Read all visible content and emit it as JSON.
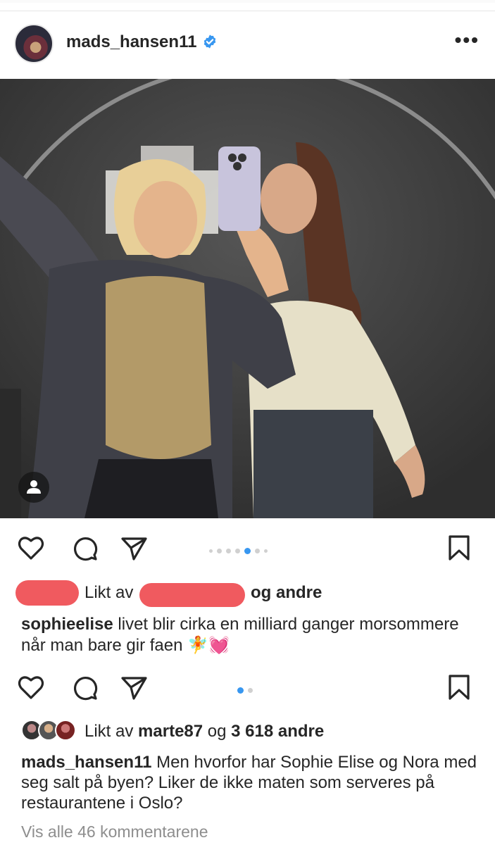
{
  "post": {
    "username": "mads_hansen11",
    "verified": true,
    "more_label": "•••"
  },
  "inner_post": {
    "liked_by_prefix": "Likt av",
    "liked_by_suffix": "og andre",
    "caption_user": "sophieelise",
    "caption_text": "livet blir cirka en milliard ganger morsommere når man bare gir faen",
    "caption_emoji": "🧚💓"
  },
  "outer_post": {
    "liked_by_prefix": "Likt av",
    "liked_by_user": "marte87",
    "liked_by_middle": "og",
    "liked_by_count": "3 618 andre",
    "caption_user": "mads_hansen11",
    "caption_text": "Men hvorfor har Sophie Elise og Nora med seg salt på byen? Liker de ikke maten som serveres på restaurantene i Oslo?",
    "view_all_comments": "Vis alle 46 kommentarene"
  },
  "carousel_inner": {
    "count": 7,
    "active_index": 4
  },
  "carousel_outer": {
    "count": 2,
    "active_index": 0
  },
  "colors": {
    "accent_blue": "#3897f0",
    "redaction": "#f05a5f",
    "text": "#262626",
    "muted": "#8e8e8e"
  },
  "icons": [
    "verified-badge-icon",
    "more-options-icon",
    "person-tag-icon",
    "heart-icon",
    "comment-icon",
    "share-icon",
    "bookmark-icon"
  ]
}
